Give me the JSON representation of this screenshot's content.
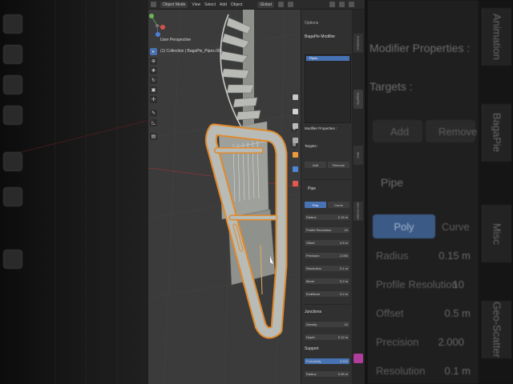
{
  "background_right": {
    "modifier_properties": "Modifier Properties :",
    "targets": "Targets :",
    "add": "Add",
    "remove": "Remove",
    "section": "Pipe",
    "poly": "Poly",
    "curve": "Curve",
    "fields": [
      {
        "label": "Radius",
        "value": "0.15 m"
      },
      {
        "label": "Profile Resolution",
        "value": "10"
      },
      {
        "label": "Offset",
        "value": "0.5 m"
      },
      {
        "label": "Precision",
        "value": "2.000"
      },
      {
        "label": "Resolution",
        "value": "0.1 m"
      }
    ],
    "side_tabs": [
      "Animation",
      "BagaPie",
      "Misc",
      "Geo-Scatter"
    ]
  },
  "topbar": {
    "mode": "Object Mode",
    "menus": [
      "View",
      "Select",
      "Add",
      "Object"
    ],
    "orientation": "Global",
    "options": "Options"
  },
  "viewport": {
    "view_name": "User Perspective",
    "collection": "(1) Collection | BagaPie_Pipes.001"
  },
  "properties": {
    "modifier_title": "BagaPie Modifier",
    "list_item": "Pipes",
    "modifier_properties": "Modifier Properties :",
    "targets": "Targets :",
    "add": "Add",
    "remove": "Remove",
    "pipe_section": "Pipe",
    "poly": "Poly",
    "curve": "Curve",
    "rows": [
      {
        "label": "Radius",
        "value": "0.15 m"
      },
      {
        "label": "Profile Resolution",
        "value": "10"
      },
      {
        "label": "Offset",
        "value": "0.5 m"
      },
      {
        "label": "Precision",
        "value": "2.000"
      },
      {
        "label": "Resolution",
        "value": "0.1 m"
      },
      {
        "label": "Bevel",
        "value": "0.2 m"
      },
      {
        "label": "EndBevel",
        "value": "0.2 m"
      }
    ],
    "junctions_section": "Junctions",
    "junction_rows": [
      {
        "label": "Density",
        "value": "10"
      },
      {
        "label": "Depth",
        "value": "0.12 m"
      }
    ],
    "support_section": "Support",
    "support_rows": [
      {
        "label": "Probability",
        "value": "0.500"
      },
      {
        "label": "Radius",
        "value": "0.05 m"
      }
    ]
  },
  "colors": {
    "accent": "#4772b3",
    "selection": "#e08a2c",
    "viewport_bg": "#3b3b3b"
  }
}
